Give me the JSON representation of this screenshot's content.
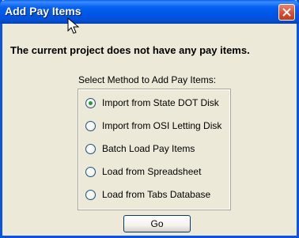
{
  "window": {
    "title": "Add Pay Items"
  },
  "message": "The current project does not have any pay items.",
  "method_label": "Select Method to Add Pay Items:",
  "options": [
    {
      "label": "Import from State DOT Disk",
      "selected": true
    },
    {
      "label": "Import from OSI Letting Disk",
      "selected": false
    },
    {
      "label": "Batch Load Pay Items",
      "selected": false
    },
    {
      "label": "Load from Spreadsheet",
      "selected": false
    },
    {
      "label": "Load from Tabs Database",
      "selected": false
    }
  ],
  "go_button": "Go",
  "colors": {
    "titlebar": "#0055E5",
    "dialog_bg": "#ECE9D8",
    "close": "#DA5232"
  }
}
